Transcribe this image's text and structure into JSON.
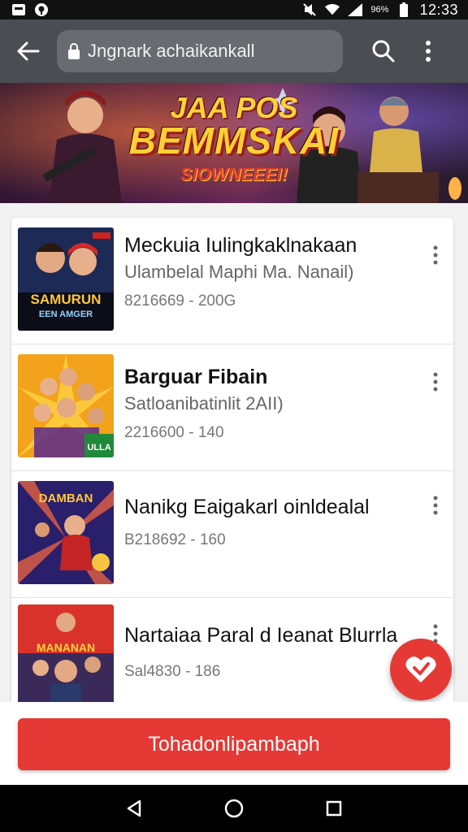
{
  "status_bar": {
    "battery": "96%",
    "time": "12:33",
    "icons": [
      "notification-icon",
      "app-icon",
      "mute-icon",
      "wifi-icon",
      "signal-icon",
      "battery-icon"
    ]
  },
  "toolbar": {
    "url": "Jngnark achaikankall",
    "icons": [
      "back-arrow-icon",
      "lock-icon",
      "search-icon",
      "overflow-menu-icon"
    ]
  },
  "banner": {
    "line1": "JAA POS",
    "line2": "BEMMSKAI",
    "line3": "SIOWNEEEI!"
  },
  "list": [
    {
      "title": "Meckuia Iulingkaklnakaan",
      "subtitle": "Ulambelal Maphi Ma. Nanail)",
      "meta": "8216669 - 200G",
      "thumb_text": [
        "SAMURUN",
        "EEN AMGER"
      ],
      "title_bold": false
    },
    {
      "title": "Barguar Fibain",
      "subtitle": "Satloanibatinlit 2AII)",
      "meta": "2216600 - 140",
      "thumb_text": [
        "ULLA"
      ],
      "title_bold": true
    },
    {
      "title": "Nanikg Eaigakarl oinldealal",
      "subtitle": "",
      "meta": "B218692 - 160",
      "thumb_text": [
        "DAMBAN"
      ],
      "title_bold": false
    },
    {
      "title": "Nartaiaa Paral d Ieanat Blurrla",
      "subtitle": "",
      "meta": "Sal4830 - 186",
      "thumb_text": [
        "MANANAN"
      ],
      "title_bold": false
    }
  ],
  "fab": {
    "icon": "check-heart-icon"
  },
  "primary_button": {
    "label": "Tohadonlipambaph"
  },
  "colors": {
    "accent": "#e53935",
    "toolbar": "#4a4d52",
    "url_pill": "#686b70"
  },
  "nav_bar": {
    "icons": [
      "back-triangle-icon",
      "home-circle-icon",
      "recents-square-icon"
    ]
  }
}
